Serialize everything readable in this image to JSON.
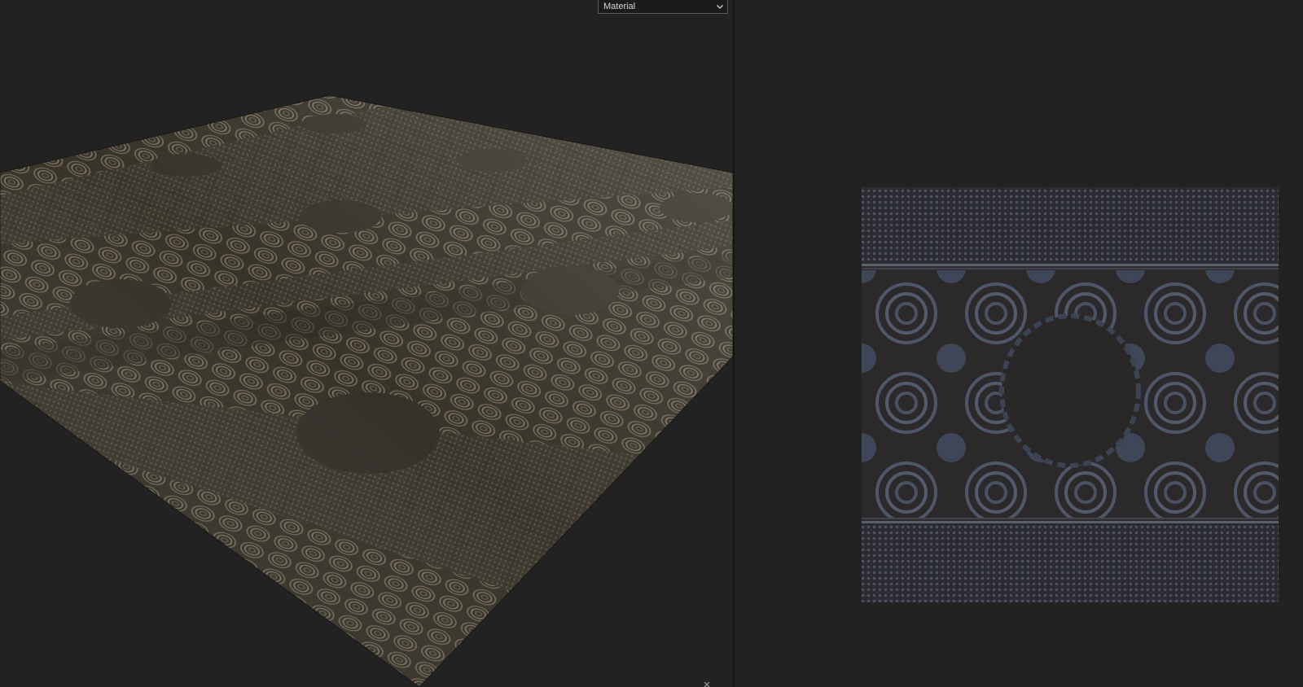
{
  "viewport3d": {
    "mode_dropdown": {
      "selected": "Material"
    }
  },
  "viewport2d": {},
  "colors": {
    "background": "#222222",
    "material_base": "#3a352c",
    "material_highlight": "#8d8470",
    "material_2d_base": "#2b2a2d",
    "material_2d_highlight": "#5e6679"
  },
  "icons": {
    "dropdown": "chevron-down-icon",
    "close": "close-icon"
  }
}
